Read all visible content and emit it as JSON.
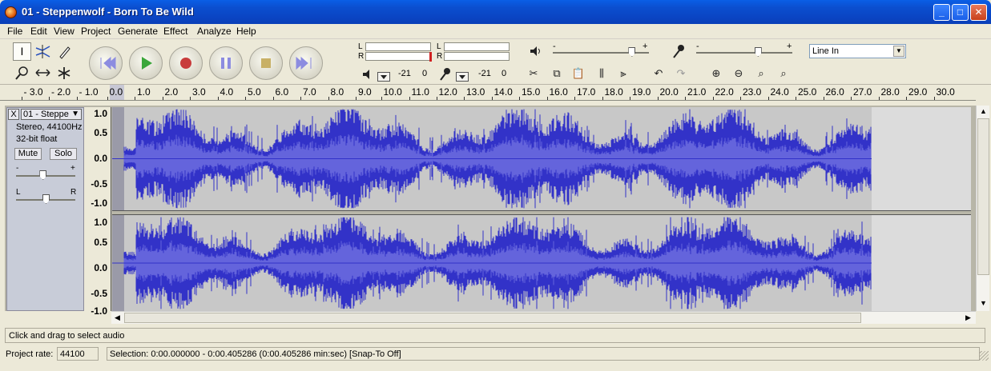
{
  "window": {
    "title": "01 - Steppenwolf - Born To Be Wild",
    "minimize": "_",
    "maximize": "□",
    "close": "✕"
  },
  "menu": [
    "File",
    "Edit",
    "View",
    "Project",
    "Generate",
    "Effect",
    "Analyze",
    "Help"
  ],
  "tools": {
    "selection_icon": "I",
    "envelope_icon": "envelope-icon",
    "draw_icon": "pencil-icon",
    "zoom_icon": "magnifier-icon",
    "timeshift_icon": "arrows-icon",
    "multi_icon": "asterisk-icon"
  },
  "meters": {
    "play_left": "L",
    "play_right": "R",
    "rec_left": "L",
    "rec_right": "R",
    "play_db": "-21",
    "play_zero": "0",
    "rec_db": "-21",
    "rec_zero": "0"
  },
  "mixer": {
    "out_minus": "-",
    "out_plus": "+",
    "in_minus": "-",
    "in_plus": "+",
    "out_level": 0.82,
    "in_level": 0.64,
    "input_source": "Line In"
  },
  "ruler": {
    "labels": [
      "- 3.0",
      "- 2.0",
      "- 1.0",
      "0.0",
      "1.0",
      "2.0",
      "3.0",
      "4.0",
      "5.0",
      "6.0",
      "7.0",
      "8.0",
      "9.0",
      "10.0",
      "11.0",
      "12.0",
      "13.0",
      "14.0",
      "15.0",
      "16.0",
      "17.0",
      "18.0",
      "19.0",
      "20.0",
      "21.0",
      "22.0",
      "23.0",
      "24.0",
      "25.0",
      "26.0",
      "27.0",
      "28.0",
      "29.0",
      "30.0"
    ]
  },
  "track": {
    "close": "X",
    "name": "01 - Steppe",
    "dropdown": "▼",
    "format": "Stereo, 44100Hz",
    "bitdepth": "32-bit float",
    "mute": "Mute",
    "solo": "Solo",
    "gain_minus": "-",
    "gain_plus": "+",
    "pan_left": "L",
    "pan_right": "R",
    "gain_level": 0.45,
    "pan_level": 0.5
  },
  "vruler": {
    "upper": [
      "1.0",
      "0.5",
      "0.0",
      "-0.5",
      "-1.0"
    ],
    "lower": [
      "1.0",
      "0.5",
      "0.0",
      "-0.5",
      "-1.0"
    ]
  },
  "colors": {
    "wave": "#3232c8",
    "wave_rms": "#6464dc",
    "wave_bg": "#c8c8c8",
    "selection": "#9a9aa8"
  },
  "status": {
    "message": "Click and drag to select audio"
  },
  "bottom": {
    "rate_label": "Project rate:",
    "rate_value": "44100",
    "selection": "Selection: 0:00.000000 - 0:00.405286 (0:00.405286 min:sec)    [Snap-To Off]"
  }
}
